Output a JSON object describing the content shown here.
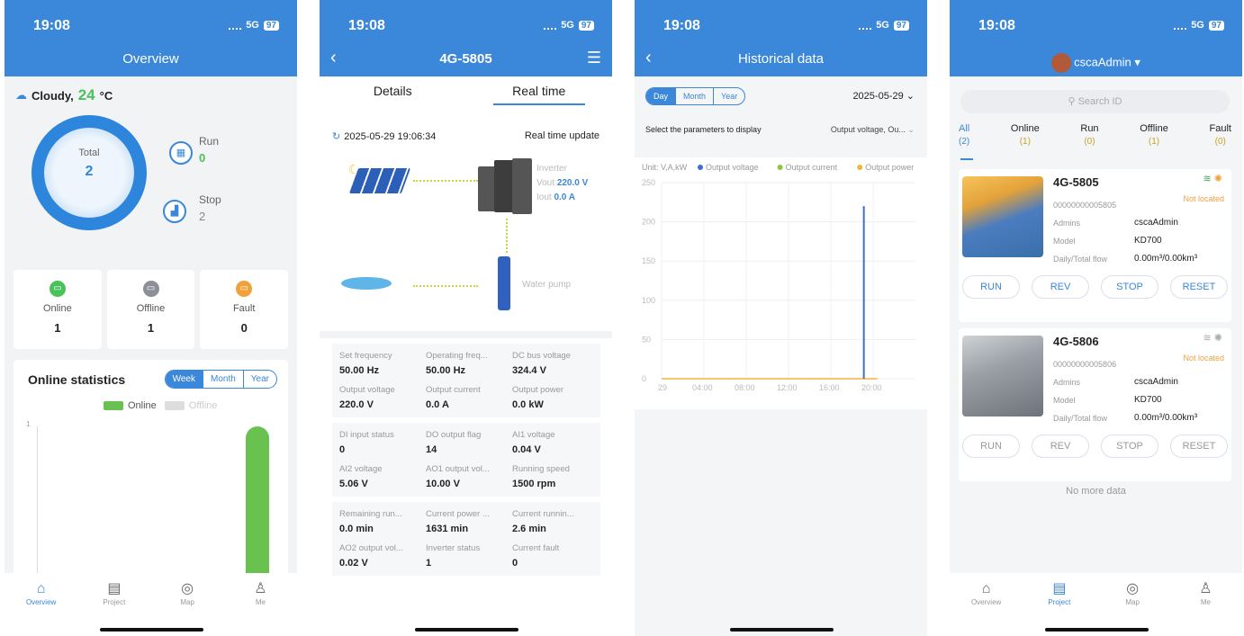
{
  "status": {
    "time": "19:08",
    "network": "5G",
    "battery": "97"
  },
  "p1": {
    "title": "Overview",
    "weather": "Cloudy,",
    "temp": "24",
    "unit": "°C",
    "total_label": "Total",
    "total_value": "2",
    "run_label": "Run",
    "run_value": "0",
    "stop_label": "Stop",
    "stop_value": "2",
    "cards": [
      {
        "label": "Online",
        "value": "1"
      },
      {
        "label": "Offline",
        "value": "1"
      },
      {
        "label": "Fault",
        "value": "0"
      }
    ],
    "stat_title": "Online statistics",
    "seg": [
      "Week",
      "Month",
      "Year"
    ],
    "legend_online": "Online",
    "legend_offline": "Offline",
    "y_tick": "1",
    "online_fraction": 1,
    "nav": [
      "Overview",
      "Project",
      "Map",
      "Me"
    ]
  },
  "p2": {
    "title": "4G-5805",
    "tab_details": "Details",
    "tab_realtime": "Real time",
    "timestamp": "2025-05-29 19:06:34",
    "rt_label": "Real time update",
    "inverter": "Inverter",
    "vout": "Vout",
    "vout_val": "220.0 V",
    "iout": "Iout",
    "iout_val": "0.0 A",
    "pump": "Water pump",
    "rows": [
      [
        {
          "l": "Set frequency",
          "v": "50.00 Hz"
        },
        {
          "l": "Operating freq...",
          "v": "50.00 Hz"
        },
        {
          "l": "DC bus voltage",
          "v": "324.4 V"
        }
      ],
      [
        {
          "l": "Output voltage",
          "v": "220.0 V"
        },
        {
          "l": "Output current",
          "v": "0.0 A"
        },
        {
          "l": "Output power",
          "v": "0.0 kW"
        }
      ],
      [
        {
          "l": "DI input status",
          "v": "0"
        },
        {
          "l": "DO output flag",
          "v": "14"
        },
        {
          "l": "AI1 voltage",
          "v": "0.04 V"
        }
      ],
      [
        {
          "l": "AI2 voltage",
          "v": "5.06 V"
        },
        {
          "l": "AO1 output vol...",
          "v": "10.00 V"
        },
        {
          "l": "Running speed",
          "v": "1500 rpm"
        }
      ],
      [
        {
          "l": "Remaining run...",
          "v": "0.0 min"
        },
        {
          "l": "Current power ...",
          "v": "1631 min"
        },
        {
          "l": "Current runnin...",
          "v": "2.6 min"
        }
      ],
      [
        {
          "l": "AO2 output vol...",
          "v": "0.02 V"
        },
        {
          "l": "Inverter status",
          "v": "1"
        },
        {
          "l": "Current fault",
          "v": "0"
        }
      ]
    ]
  },
  "p3": {
    "title": "Historical data",
    "seg": [
      "Day",
      "Month",
      "Year"
    ],
    "date": "2025-05-29",
    "param_label": "Select the parameters to display",
    "param_value": "Output voltage, Ou...",
    "chart_data": {
      "type": "line",
      "unit": "Unit: V,A,kW",
      "legend": [
        "Output voltage",
        "Output current",
        "Output power"
      ],
      "colors": [
        "#3b6fd0",
        "#8cc63f",
        "#f2b53a"
      ],
      "yticks": [
        "250",
        "200",
        "150",
        "100",
        "50",
        "0"
      ],
      "xticks": [
        "29",
        "04:00",
        "08:00",
        "12:00",
        "16:00",
        "20:00"
      ],
      "ylim": [
        0,
        250
      ],
      "series": [
        {
          "name": "Output voltage",
          "spike_at": "~19:06",
          "value": 220
        }
      ]
    }
  },
  "p4": {
    "user": "cscaAdmin",
    "search": "Search ID",
    "filters": [
      {
        "l": "All",
        "c": "(2)"
      },
      {
        "l": "Online",
        "c": "(1)"
      },
      {
        "l": "Run",
        "c": "(0)"
      },
      {
        "l": "Offline",
        "c": "(1)"
      },
      {
        "l": "Fault",
        "c": "(0)"
      }
    ],
    "devices": [
      {
        "name": "4G-5805",
        "id": "00000000005805",
        "loc": "Not located",
        "admins_l": "Admins",
        "admins": "cscaAdmin",
        "model_l": "Model",
        "model": "KD700",
        "flow_l": "Daily/Total flow",
        "flow": "0.00m³/0.00km³"
      },
      {
        "name": "4G-5806",
        "id": "00000000005806",
        "loc": "Not located",
        "admins_l": "Admins",
        "admins": "cscaAdmin",
        "model_l": "Model",
        "model": "KD700",
        "flow_l": "Daily/Total flow",
        "flow": "0.00m³/0.00km³"
      }
    ],
    "btns": [
      "RUN",
      "REV",
      "STOP",
      "RESET"
    ],
    "nomore": "No more data",
    "nav": [
      "Overview",
      "Project",
      "Map",
      "Me"
    ]
  }
}
